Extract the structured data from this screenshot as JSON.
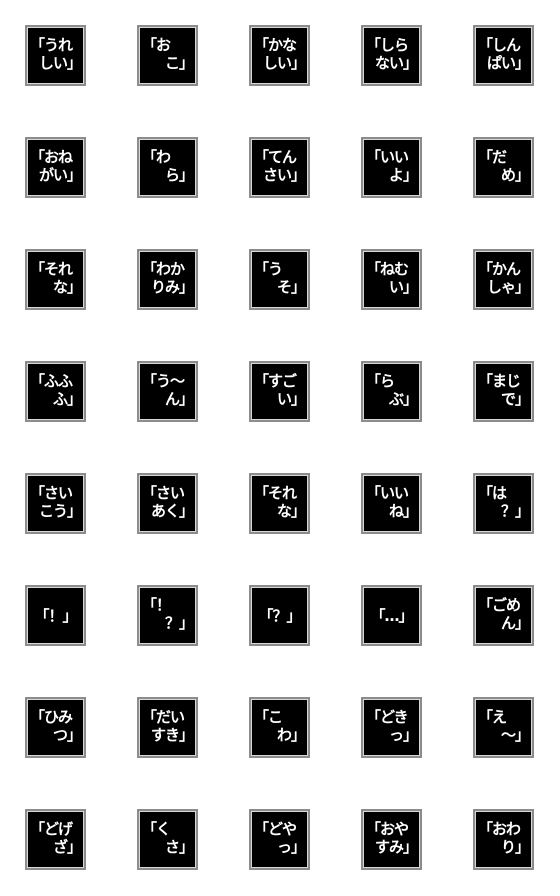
{
  "sheet": {
    "tile_colors": {
      "background": "#000000",
      "text": "#ffffff",
      "border": "#8c8c8c",
      "inner_border": "#d8d8d8",
      "page": "#ffffff"
    },
    "tiles": [
      {
        "line1": "「うれ",
        "line2": "しい」",
        "text": "うれしい"
      },
      {
        "line1": "「おこ",
        "line2": "」",
        "text": "おこ",
        "l1": "「お",
        "l2": "こ」"
      },
      {
        "line1": "「かな",
        "line2": "しい」",
        "text": "かなしい"
      },
      {
        "line1": "「しら",
        "line2": "ない」",
        "text": "しらない"
      },
      {
        "line1": "「しん",
        "line2": "ぱい」",
        "text": "しんぱい"
      },
      {
        "line1": "「おね",
        "line2": "がい」",
        "text": "おねがい"
      },
      {
        "line1": "「わ",
        "line2": "ら」",
        "text": "わら"
      },
      {
        "line1": "「てん",
        "line2": "さい」",
        "text": "てんさい"
      },
      {
        "line1": "「いい",
        "line2": "よ」",
        "text": "いいよ"
      },
      {
        "line1": "「だ",
        "line2": "め」",
        "text": "だめ"
      },
      {
        "line1": "「それ",
        "line2": "な」",
        "text": "それな"
      },
      {
        "line1": "「わか",
        "line2": "りみ」",
        "text": "わかりみ"
      },
      {
        "line1": "「う",
        "line2": "そ」",
        "text": "うそ"
      },
      {
        "line1": "「ねむ",
        "line2": "い」",
        "text": "ねむい"
      },
      {
        "line1": "「かん",
        "line2": "しゃ」",
        "text": "かんしゃ"
      },
      {
        "line1": "「ふふ",
        "line2": "ふ」",
        "text": "ふふふ"
      },
      {
        "line1": "「う〜",
        "line2": "ん」",
        "text": "う〜ん"
      },
      {
        "line1": "「すご",
        "line2": "い」",
        "text": "すごい"
      },
      {
        "line1": "「ら",
        "line2": "ぶ」",
        "text": "らぶ"
      },
      {
        "line1": "「まじ",
        "line2": "で」",
        "text": "まじで"
      },
      {
        "line1": "「さい",
        "line2": "こう」",
        "text": "さいこう"
      },
      {
        "line1": "「さい",
        "line2": "あく」",
        "text": "さいあく"
      },
      {
        "line1": "「それ",
        "line2": "な」",
        "text": "それな"
      },
      {
        "line1": "「いい",
        "line2": "ね」",
        "text": "いいね"
      },
      {
        "line1": "「は",
        "line2": "？」",
        "text": "は？"
      },
      {
        "line1": "「！」",
        "line2": "",
        "text": "！",
        "single": true
      },
      {
        "line1": "「！",
        "line2": "？」",
        "text": "！？"
      },
      {
        "line1": "「？」",
        "line2": "",
        "text": "？",
        "single": true
      },
      {
        "line1": "「…」",
        "line2": "",
        "text": "…",
        "single": true
      },
      {
        "line1": "「ごめ",
        "line2": "ん」",
        "text": "ごめん"
      },
      {
        "line1": "「ひみ",
        "line2": "つ」",
        "text": "ひみつ"
      },
      {
        "line1": "「だい",
        "line2": "すき」",
        "text": "だいすき"
      },
      {
        "line1": "「こ",
        "line2": "わ」",
        "text": "こわ"
      },
      {
        "line1": "「どき",
        "line2": "っ」",
        "text": "どきっ"
      },
      {
        "line1": "「え",
        "line2": "〜」",
        "text": "え〜"
      },
      {
        "line1": "「どげ",
        "line2": "ざ」",
        "text": "どげざ"
      },
      {
        "line1": "「く",
        "line2": "さ」",
        "text": "くさ"
      },
      {
        "line1": "「どや",
        "line2": "っ」",
        "text": "どやっ"
      },
      {
        "line1": "「おや",
        "line2": "すみ」",
        "text": "おやすみ"
      },
      {
        "line1": "「おわ",
        "line2": "り」",
        "text": "おわり"
      }
    ]
  }
}
